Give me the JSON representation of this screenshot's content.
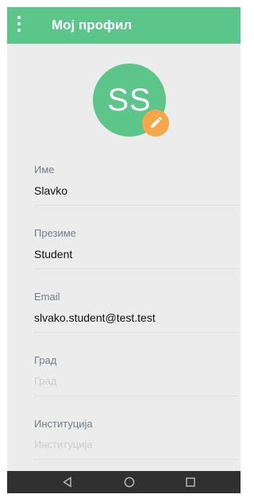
{
  "app_bar": {
    "title": "Мој профил",
    "menu_icon": "more-vert-icon",
    "background": "#5cc68a"
  },
  "avatar": {
    "initials": "SS",
    "color": "#5cc68a",
    "edit_icon": "pencil-icon",
    "edit_color": "#f7a64a"
  },
  "fields": [
    {
      "label": "Име",
      "value": "Slavko",
      "placeholder": ""
    },
    {
      "label": "Презиме",
      "value": "Student",
      "placeholder": ""
    },
    {
      "label": "Email",
      "value": "slvako.student@test.test",
      "placeholder": ""
    },
    {
      "label": "Град",
      "value": "",
      "placeholder": "Град"
    },
    {
      "label": "Институција",
      "value": "",
      "placeholder": "Институција"
    }
  ],
  "nav_bar": {
    "back_icon": "back-triangle-icon",
    "home_icon": "home-circle-icon",
    "recents_icon": "recents-square-icon"
  }
}
